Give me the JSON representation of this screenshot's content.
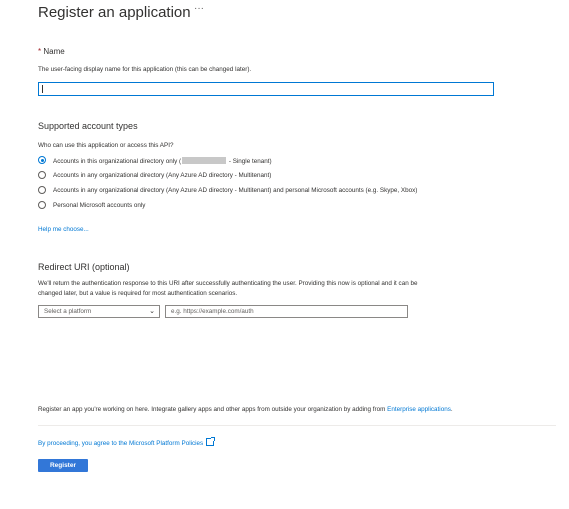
{
  "header": {
    "title": "Register an application",
    "more_label": "···"
  },
  "name_section": {
    "required_marker": "*",
    "label": "Name",
    "description": "The user-facing display name for this application (this can be changed later).",
    "value": ""
  },
  "account_types": {
    "heading": "Supported account types",
    "question": "Who can use this application or access this API?",
    "options": [
      {
        "label_prefix": "Accounts in this organizational directory only (",
        "label_redacted": true,
        "label_suffix": " - Single tenant)",
        "checked": true
      },
      {
        "label": "Accounts in any organizational directory (Any Azure AD directory - Multitenant)",
        "checked": false
      },
      {
        "label": "Accounts in any organizational directory (Any Azure AD directory - Multitenant) and personal Microsoft accounts (e.g. Skype, Xbox)",
        "checked": false
      },
      {
        "label": "Personal Microsoft accounts only",
        "checked": false
      }
    ],
    "help_link": "Help me choose..."
  },
  "redirect": {
    "heading": "Redirect URI (optional)",
    "description_line1": "We'll return the authentication response to this URI after successfully authenticating the user. Providing this now is optional and it can be",
    "description_line2": "changed later, but a value is required for most authentication scenarios.",
    "platform_placeholder": "Select a platform",
    "uri_placeholder": "e.g. https://example.com/auth"
  },
  "footer": {
    "note_text": "Register an app you're working on here. Integrate gallery apps and other apps from outside your organization by adding from ",
    "note_link": "Enterprise applications",
    "note_end": ".",
    "policy_text": "By proceeding, you agree to the Microsoft Platform Policies",
    "register_label": "Register"
  },
  "colors": {
    "accent": "#0078d4",
    "button": "#3277d8"
  }
}
